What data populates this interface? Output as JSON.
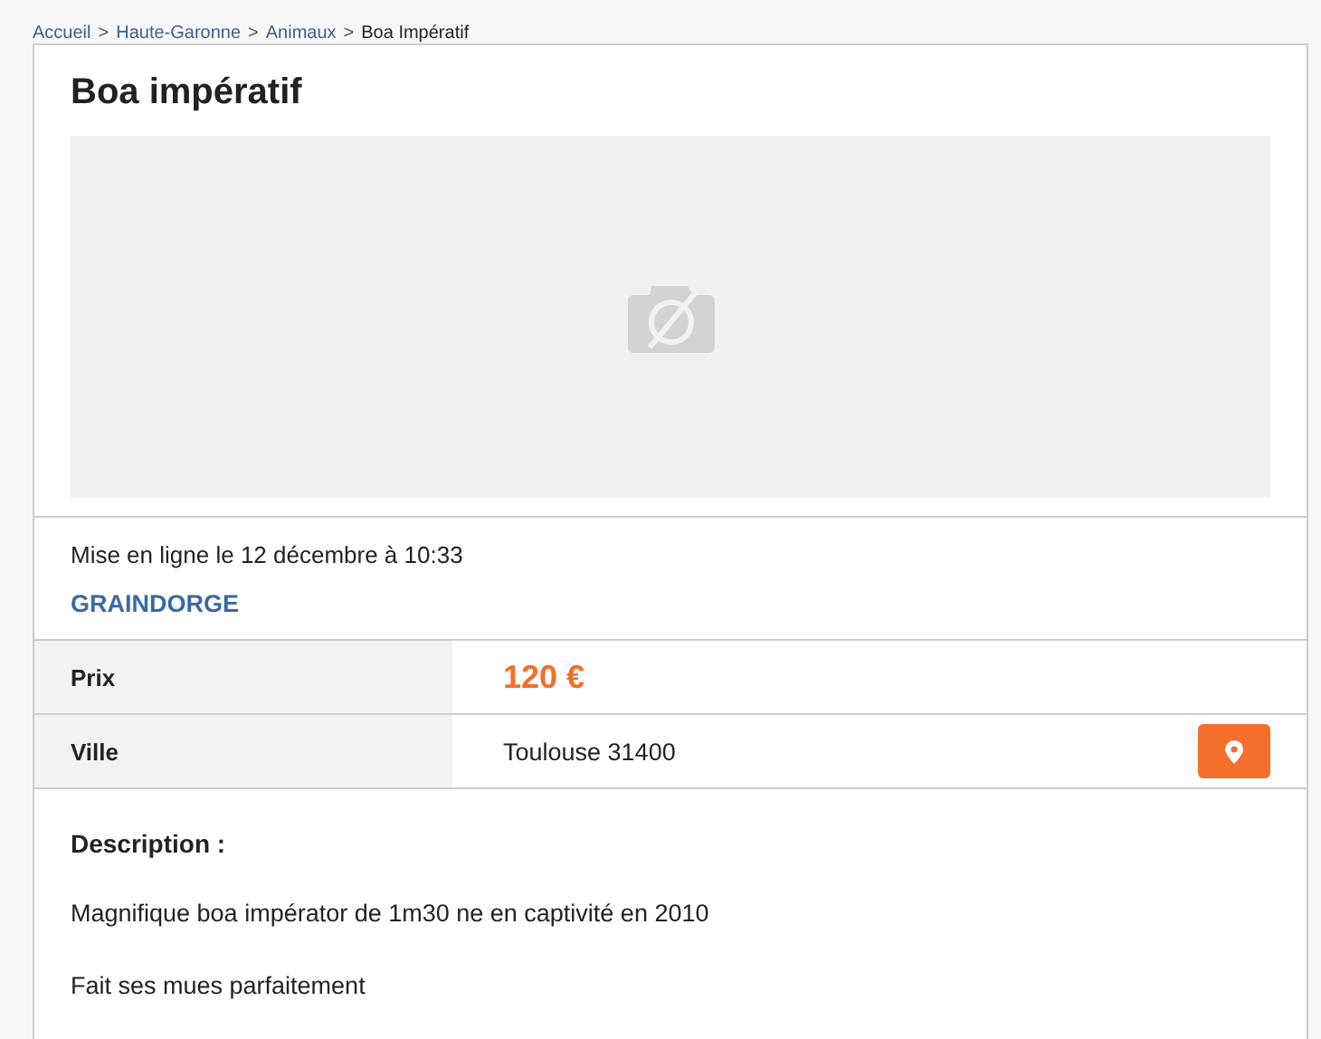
{
  "breadcrumb": {
    "separator": ">",
    "items": [
      {
        "label": "Accueil",
        "current": false
      },
      {
        "label": "Haute-Garonne",
        "current": false
      },
      {
        "label": "Animaux",
        "current": false
      },
      {
        "label": "Boa Impératif",
        "current": true
      }
    ]
  },
  "listing": {
    "title": "Boa impératif",
    "image": {
      "kind": "placeholder"
    },
    "posted": "Mise en ligne le 12 décembre à 10:33",
    "seller": "GRAINDORGE",
    "details": [
      {
        "label": "Prix",
        "value": "120 €",
        "kind": "price"
      },
      {
        "label": "Ville",
        "value": "Toulouse 31400",
        "kind": "location"
      }
    ],
    "description": {
      "heading": "Description :",
      "paragraphs": [
        "Magnifique boa impérator de 1m30 ne en captivité en 2010",
        "Fait ses mues parfaitement"
      ]
    }
  }
}
